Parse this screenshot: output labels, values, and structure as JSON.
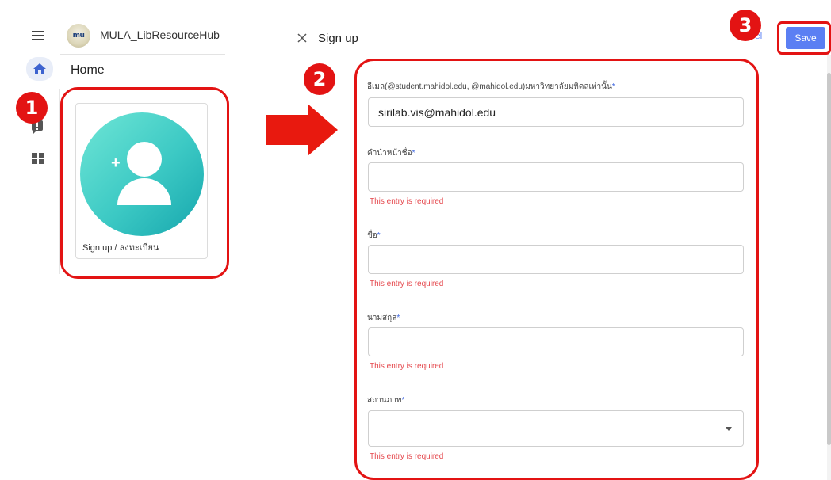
{
  "app": {
    "name": "MULA_LibResourceHub",
    "logo_text": "mu"
  },
  "sidebar": {
    "items": [
      {
        "icon": "home-icon"
      },
      {
        "icon": "feedback-icon"
      },
      {
        "icon": "grid-icon"
      }
    ]
  },
  "home": {
    "title": "Home",
    "card_label": "Sign up / ลงทะเบียน"
  },
  "dialog": {
    "title": "Sign up",
    "cancel_label": "el",
    "save_label": "Save",
    "fields": [
      {
        "label": "อีเมล(@student.mahidol.edu, @mahidol.edu)มหาวิทยาลัยมหิดลเท่านั้น",
        "required_mark": "*",
        "value": "sirilab.vis@mahidol.edu",
        "error": ""
      },
      {
        "label": "คำนำหน้าชื่อ",
        "required_mark": "*",
        "value": "",
        "error": "This entry is required"
      },
      {
        "label": "ชื่อ",
        "required_mark": "*",
        "value": "",
        "error": "This entry is required"
      },
      {
        "label": "นามสกุล",
        "required_mark": "*",
        "value": "",
        "error": "This entry is required"
      },
      {
        "label": "สถานภาพ",
        "required_mark": "*",
        "value": "",
        "error": "This entry is required"
      }
    ]
  },
  "annotations": {
    "badges": [
      "1",
      "2",
      "3"
    ],
    "color": "#e31313"
  },
  "colors": {
    "accent": "#5b7ff3",
    "error": "#e5484d",
    "avatar_gradient_start": "#6fe6d6",
    "avatar_gradient_end": "#16a6ad"
  }
}
